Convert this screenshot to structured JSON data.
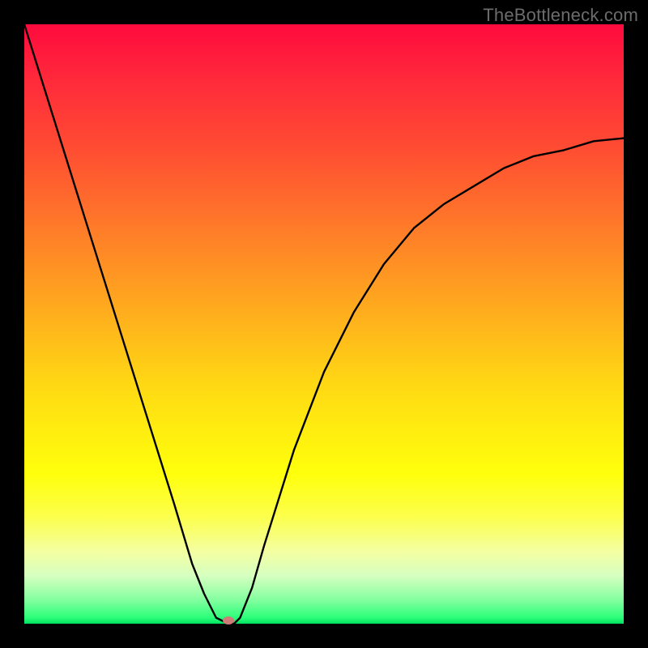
{
  "watermark": "TheBottleneck.com",
  "colors": {
    "frame": "#000000",
    "gradient_top": "#ff0a3e",
    "gradient_mid": "#ffd814",
    "gradient_bottom": "#00e060",
    "curve": "#000000",
    "marker": "#cf7b78"
  },
  "chart_data": {
    "type": "line",
    "title": "",
    "xlabel": "",
    "ylabel": "",
    "xlim": [
      0,
      100
    ],
    "ylim": [
      0,
      100
    ],
    "series": [
      {
        "name": "bottleneck-curve",
        "x": [
          0,
          5,
          10,
          15,
          20,
          25,
          28,
          30,
          32,
          34,
          35,
          36,
          38,
          40,
          45,
          50,
          55,
          60,
          65,
          70,
          75,
          80,
          85,
          90,
          95,
          100
        ],
        "values": [
          100,
          84,
          68,
          52,
          36,
          20,
          10,
          5,
          1,
          0,
          0,
          1,
          6,
          13,
          29,
          42,
          52,
          60,
          66,
          70,
          73,
          76,
          78,
          79,
          80.5,
          81
        ]
      }
    ],
    "annotations": [
      {
        "name": "minimum-marker",
        "x": 34,
        "y": 0.5
      }
    ],
    "grid": false,
    "legend": false
  }
}
